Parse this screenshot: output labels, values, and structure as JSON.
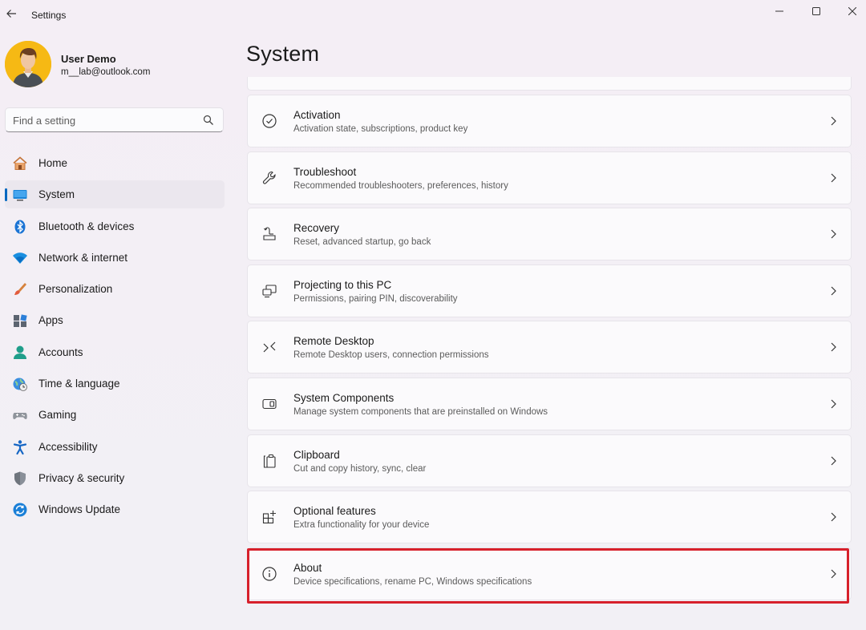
{
  "window": {
    "title": "Settings"
  },
  "user": {
    "name": "User Demo",
    "email": "m__lab@outlook.com"
  },
  "search": {
    "placeholder": "Find a setting"
  },
  "nav": {
    "items": [
      {
        "label": "Home",
        "icon": "home-icon"
      },
      {
        "label": "System",
        "icon": "system-icon",
        "selected": true
      },
      {
        "label": "Bluetooth & devices",
        "icon": "bluetooth-icon"
      },
      {
        "label": "Network & internet",
        "icon": "wifi-icon"
      },
      {
        "label": "Personalization",
        "icon": "brush-icon"
      },
      {
        "label": "Apps",
        "icon": "apps-icon"
      },
      {
        "label": "Accounts",
        "icon": "account-icon"
      },
      {
        "label": "Time & language",
        "icon": "globe-clock-icon"
      },
      {
        "label": "Gaming",
        "icon": "gamepad-icon"
      },
      {
        "label": "Accessibility",
        "icon": "accessibility-icon"
      },
      {
        "label": "Privacy & security",
        "icon": "shield-icon"
      },
      {
        "label": "Windows Update",
        "icon": "update-icon"
      }
    ]
  },
  "main": {
    "title": "System",
    "cards": [
      {
        "title": "Activation",
        "description": "Activation state, subscriptions, product key",
        "icon": "check-circle-icon"
      },
      {
        "title": "Troubleshoot",
        "description": "Recommended troubleshooters, preferences, history",
        "icon": "wrench-icon"
      },
      {
        "title": "Recovery",
        "description": "Reset, advanced startup, go back",
        "icon": "recovery-icon"
      },
      {
        "title": "Projecting to this PC",
        "description": "Permissions, pairing PIN, discoverability",
        "icon": "projector-icon"
      },
      {
        "title": "Remote Desktop",
        "description": "Remote Desktop users, connection permissions",
        "icon": "remote-desktop-icon"
      },
      {
        "title": "System Components",
        "description": "Manage system components that are preinstalled on Windows",
        "icon": "components-icon"
      },
      {
        "title": "Clipboard",
        "description": "Cut and copy history, sync, clear",
        "icon": "clipboard-icon"
      },
      {
        "title": "Optional features",
        "description": "Extra functionality for your device",
        "icon": "add-grid-icon"
      },
      {
        "title": "About",
        "description": "Device specifications, rename PC, Windows specifications",
        "icon": "info-icon"
      }
    ]
  },
  "colors": {
    "accent": "#0067c0",
    "highlight": "#d7202b"
  }
}
